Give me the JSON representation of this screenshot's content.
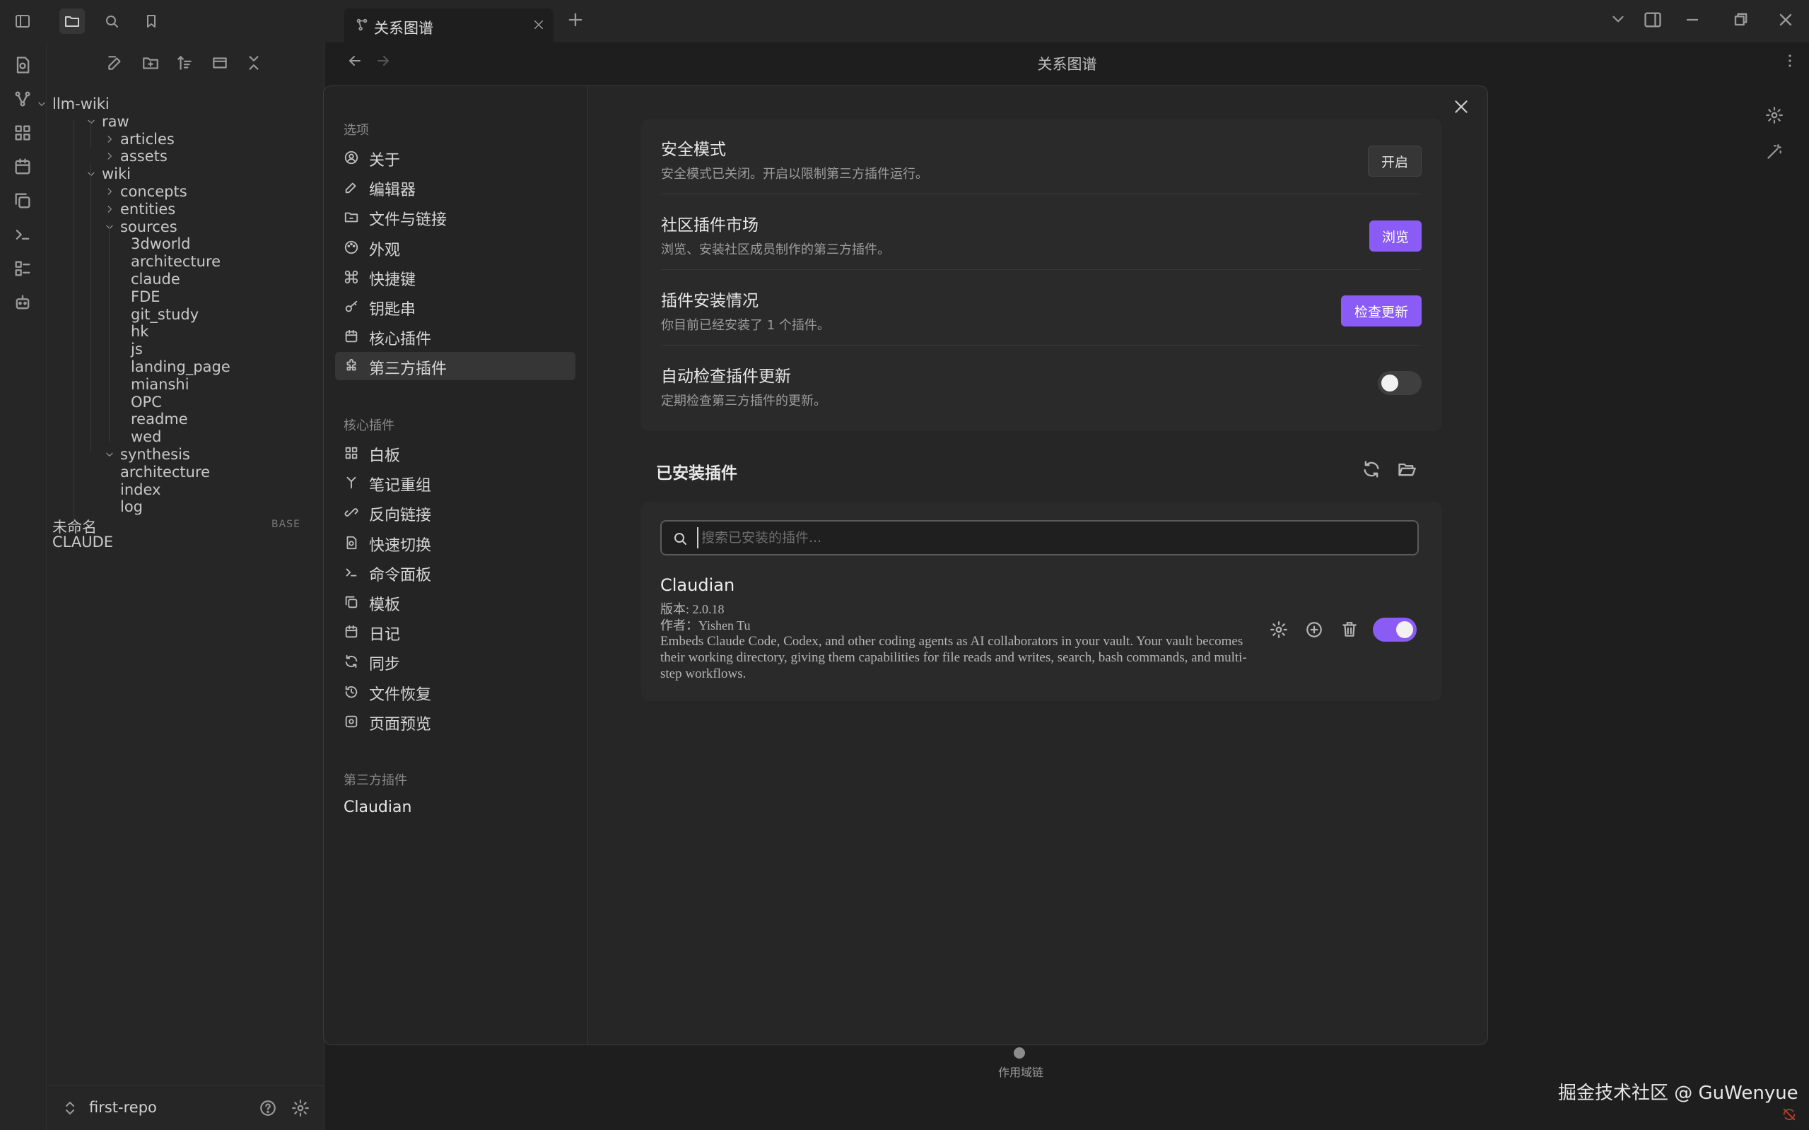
{
  "tab": {
    "title": "关系图谱"
  },
  "graph": {
    "header_title": "关系图谱",
    "scope_label": "作用域链"
  },
  "explorer": {
    "tree": [
      {
        "label": "llm-wiki",
        "depth": 0,
        "folder": true
      },
      {
        "label": "raw",
        "depth": 1,
        "folder": true
      },
      {
        "label": "articles",
        "depth": 2,
        "folder": true,
        "collapsed": true
      },
      {
        "label": "assets",
        "depth": 2,
        "folder": true,
        "collapsed": true
      },
      {
        "label": "wiki",
        "depth": 1,
        "folder": true
      },
      {
        "label": "concepts",
        "depth": 2,
        "folder": true,
        "collapsed": true
      },
      {
        "label": "entities",
        "depth": 2,
        "folder": true,
        "collapsed": true
      },
      {
        "label": "sources",
        "depth": 2,
        "folder": true
      },
      {
        "label": "3dworld",
        "depth": 3
      },
      {
        "label": "architecture",
        "depth": 3
      },
      {
        "label": "claude",
        "depth": 3
      },
      {
        "label": "FDE",
        "depth": 3
      },
      {
        "label": "git_study",
        "depth": 3
      },
      {
        "label": "hk",
        "depth": 3
      },
      {
        "label": "js",
        "depth": 3
      },
      {
        "label": "landing_page",
        "depth": 3
      },
      {
        "label": "mianshi",
        "depth": 3
      },
      {
        "label": "OPC",
        "depth": 3
      },
      {
        "label": "readme",
        "depth": 3
      },
      {
        "label": "wed",
        "depth": 3
      },
      {
        "label": "synthesis",
        "depth": 2,
        "folder": true
      },
      {
        "label": "architecture",
        "depth": 2
      },
      {
        "label": "index",
        "depth": 2
      },
      {
        "label": "log",
        "depth": 2
      },
      {
        "label": "未命名",
        "depth": 0,
        "tag": "BASE"
      },
      {
        "label": "CLAUDE",
        "depth": 0
      }
    ],
    "vault_name": "first-repo"
  },
  "settings_nav": {
    "options_heading": "选项",
    "options": [
      {
        "label": "关于",
        "icon": "user-circle-icon"
      },
      {
        "label": "编辑器",
        "icon": "pencil-icon"
      },
      {
        "label": "文件与链接",
        "icon": "folder-link-icon"
      },
      {
        "label": "外观",
        "icon": "palette-icon"
      },
      {
        "label": "快捷键",
        "icon": "command-icon"
      },
      {
        "label": "钥匙串",
        "icon": "key-icon"
      },
      {
        "label": "核心插件",
        "icon": "calendar-icon"
      },
      {
        "label": "第三方插件",
        "icon": "puzzle-icon",
        "active": true
      }
    ],
    "core_heading": "核心插件",
    "core": [
      {
        "label": "白板",
        "icon": "canvas-icon"
      },
      {
        "label": "笔记重组",
        "icon": "merge-icon"
      },
      {
        "label": "反向链接",
        "icon": "backlink-icon"
      },
      {
        "label": "快速切换",
        "icon": "file-search-icon"
      },
      {
        "label": "命令面板",
        "icon": "terminal-icon"
      },
      {
        "label": "模板",
        "icon": "copy-icon"
      },
      {
        "label": "日记",
        "icon": "calendar-icon"
      },
      {
        "label": "同步",
        "icon": "sync-icon"
      },
      {
        "label": "文件恢复",
        "icon": "history-icon"
      },
      {
        "label": "页面预览",
        "icon": "preview-icon"
      }
    ],
    "third_heading": "第三方插件",
    "third": [
      {
        "label": "Claudian"
      }
    ]
  },
  "community_plugins": {
    "rows": [
      {
        "title": "安全模式",
        "desc": "安全模式已关闭。开启以限制第三方插件运行。",
        "button": "开启"
      },
      {
        "title": "社区插件市场",
        "desc": "浏览、安装社区成员制作的第三方插件。",
        "button": "浏览"
      },
      {
        "title": "插件安装情况",
        "desc": "你目前已经安装了 1 个插件。",
        "button": "检查更新"
      },
      {
        "title": "自动检查插件更新",
        "desc": "定期检查第三方插件的更新。",
        "toggle": false
      }
    ],
    "installed_heading": "已安装插件",
    "search_placeholder": "搜索已安装的插件...",
    "plugins": [
      {
        "name": "Claudian",
        "version": "版本: 2.0.18",
        "author": "作者：Yishen Tu",
        "description": "Embeds Claude Code, Codex, and other coding agents as AI collaborators in your vault. Your vault becomes their working directory, giving them capabilities for file reads and writes, search, bash commands, and multi-step workflows.",
        "enabled": true
      }
    ]
  },
  "watermark": "掘金技术社区 @ GuWenyue",
  "colors": {
    "accent": "#8a5cf5",
    "background": "#1e1e1e",
    "panel": "#262626"
  }
}
